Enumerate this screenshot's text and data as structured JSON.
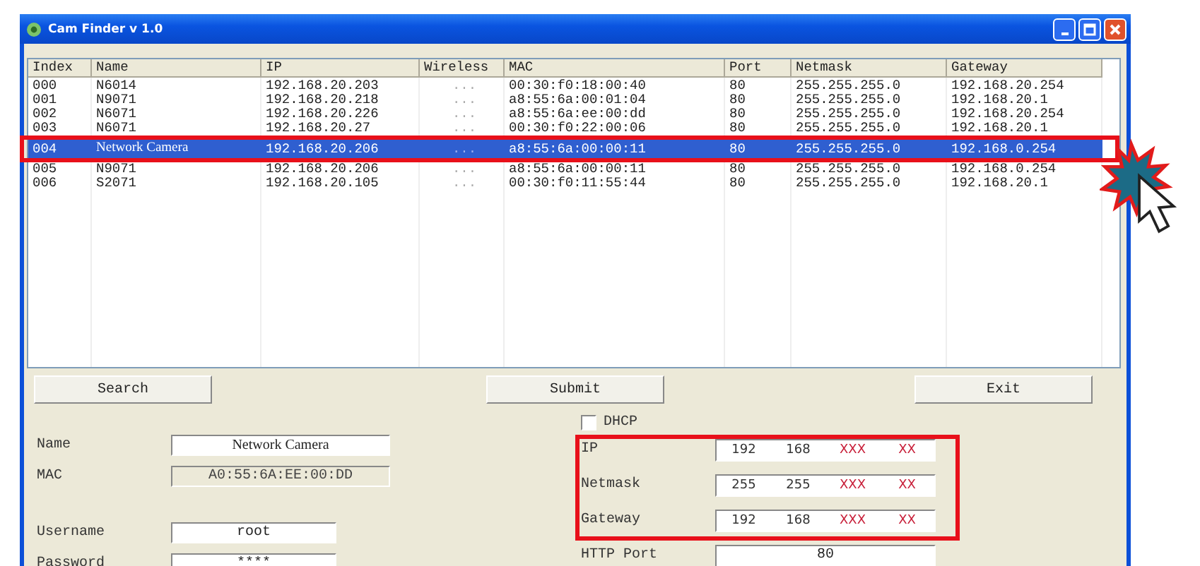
{
  "window": {
    "title": "Cam Finder v 1.0"
  },
  "table": {
    "columns": [
      "Index",
      "Name",
      "IP",
      "Wireless",
      "MAC",
      "Port",
      "Netmask",
      "Gateway"
    ],
    "rows": [
      {
        "cells": [
          "000",
          "N6014",
          "192.168.20.203",
          "...",
          "00:30:f0:18:00:40",
          "80",
          "255.255.255.0",
          "192.168.20.254"
        ],
        "selected": false
      },
      {
        "cells": [
          "001",
          "N9071",
          "192.168.20.218",
          "...",
          "a8:55:6a:00:01:04",
          "80",
          "255.255.255.0",
          "192.168.20.1"
        ],
        "selected": false
      },
      {
        "cells": [
          "002",
          "N6071",
          "192.168.20.226",
          "...",
          "a8:55:6a:ee:00:dd",
          "80",
          "255.255.255.0",
          "192.168.20.254"
        ],
        "selected": false
      },
      {
        "cells": [
          "003",
          "N6071",
          "192.168.20.27",
          "...",
          "00:30:f0:22:00:06",
          "80",
          "255.255.255.0",
          "192.168.20.1"
        ],
        "selected": false
      },
      {
        "cells": [
          "004",
          "Network Camera",
          "192.168.20.206",
          "...",
          "a8:55:6a:00:00:11",
          "80",
          "255.255.255.0",
          "192.168.0.254"
        ],
        "selected": true
      },
      {
        "cells": [
          "005",
          "N9071",
          "192.168.20.206",
          "...",
          "a8:55:6a:00:00:11",
          "80",
          "255.255.255.0",
          "192.168.0.254"
        ],
        "selected": false
      },
      {
        "cells": [
          "006",
          "S2071",
          "192.168.20.105",
          "...",
          "00:30:f0:11:55:44",
          "80",
          "255.255.255.0",
          "192.168.20.1"
        ],
        "selected": false
      }
    ]
  },
  "buttons": [
    "Search",
    "Submit",
    "Exit"
  ],
  "device": [
    {
      "label": "Name",
      "value": "Network Camera",
      "disabled": false
    },
    {
      "label": "MAC",
      "value": "A0:55:6A:EE:00:DD",
      "disabled": true
    }
  ],
  "login": [
    {
      "label": "Username",
      "value": "root"
    },
    {
      "label": "Password",
      "value": "****"
    }
  ],
  "dhcp": {
    "label": "DHCP",
    "checked": false
  },
  "network": [
    {
      "label": "IP",
      "parts": [
        {
          "text": "192",
          "masked": false
        },
        {
          "text": "168",
          "masked": false
        },
        {
          "text": "XXX",
          "masked": true
        },
        {
          "text": "XX",
          "masked": true
        }
      ]
    },
    {
      "label": "Netmask",
      "parts": [
        {
          "text": "255",
          "masked": false
        },
        {
          "text": "255",
          "masked": false
        },
        {
          "text": "XXX",
          "masked": true
        },
        {
          "text": "XX",
          "masked": true
        }
      ]
    },
    {
      "label": "Gateway",
      "parts": [
        {
          "text": "192",
          "masked": false
        },
        {
          "text": "168",
          "masked": false
        },
        {
          "text": "XXX",
          "masked": true
        },
        {
          "text": "XX",
          "masked": true
        }
      ]
    }
  ],
  "http_port": {
    "label": "HTTP Port",
    "value": "80"
  }
}
